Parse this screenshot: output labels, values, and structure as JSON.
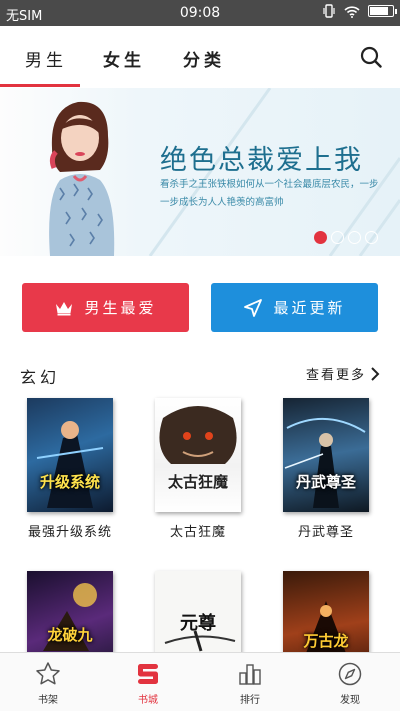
{
  "status_bar": {
    "carrier": "无SIM",
    "time": "09:08",
    "battery_level": 0.85
  },
  "top_tabs": [
    {
      "label": "男生",
      "active": true
    },
    {
      "label": "女生",
      "active": false
    },
    {
      "label": "分类",
      "active": false
    }
  ],
  "banner": {
    "title": "绝色总裁爱上我",
    "description": "看杀手之王张铁根如何从一个社会最底层农民，一步一步成长为人人艳羡的高富帅",
    "slide_count": 4,
    "active_slide": 1
  },
  "actions": {
    "favorites_label": "男生最爱",
    "recent_label": "最近更新"
  },
  "section": {
    "title": "玄幻",
    "more_label": "查看更多"
  },
  "books": [
    {
      "name": "最强升级系统",
      "cover_text": "升级系统"
    },
    {
      "name": "太古狂魔",
      "cover_text": "太古狂魔"
    },
    {
      "name": "丹武尊圣",
      "cover_text": "丹武尊圣"
    },
    {
      "name": "",
      "cover_text": "龙破九"
    },
    {
      "name": "",
      "cover_text": "元尊"
    },
    {
      "name": "",
      "cover_text": "万古龙"
    }
  ],
  "bottom_nav": [
    {
      "label": "书架",
      "icon": "star-icon",
      "active": false
    },
    {
      "label": "书城",
      "icon": "bookstore-icon",
      "active": true
    },
    {
      "label": "排行",
      "icon": "ranking-icon",
      "active": false
    },
    {
      "label": "发现",
      "icon": "compass-icon",
      "active": false
    }
  ],
  "colors": {
    "accent": "#e2333f",
    "blue": "#1e8fdc",
    "banner_text": "#1e6f8f"
  }
}
